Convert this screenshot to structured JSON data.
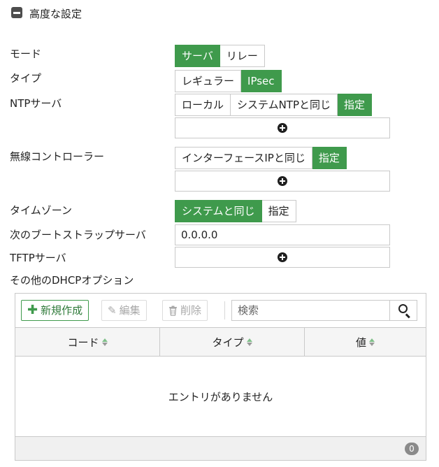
{
  "section": {
    "title": "高度な設定"
  },
  "fields": {
    "mode": {
      "label": "モード",
      "options": [
        "サーバ",
        "リレー"
      ],
      "selected": "サーバ"
    },
    "type": {
      "label": "タイプ",
      "options": [
        "レギュラー",
        "IPsec"
      ],
      "selected": "IPsec"
    },
    "ntp": {
      "label": "NTPサーバ",
      "options": [
        "ローカル",
        "システムNTPと同じ",
        "指定"
      ],
      "selected": "指定"
    },
    "wlc": {
      "label": "無線コントローラー",
      "options": [
        "インターフェースIPと同じ",
        "指定"
      ],
      "selected": "指定"
    },
    "timezone": {
      "label": "タイムゾーン",
      "options": [
        "システムと同じ",
        "指定"
      ],
      "selected": "システムと同じ"
    },
    "next_bootstrap": {
      "label": "次のブートストラップサーバ",
      "value": "0.0.0.0"
    },
    "tftp": {
      "label": "TFTPサーバ"
    },
    "other_dhcp": {
      "label": "その他のDHCPオプション"
    }
  },
  "table": {
    "toolbar": {
      "create": "新規作成",
      "edit": "編集",
      "delete": "削除",
      "search_placeholder": "検索"
    },
    "columns": [
      "コード",
      "タイプ",
      "値"
    ],
    "empty_text": "エントリがありません",
    "count": "0"
  },
  "colors": {
    "accent": "#3f9a4c",
    "border": "#c9c9c9"
  },
  "icons": [
    "collapse-icon",
    "plus-circle-icon",
    "plus-icon",
    "pencil-icon",
    "trash-icon",
    "search-icon",
    "sort-icon"
  ]
}
